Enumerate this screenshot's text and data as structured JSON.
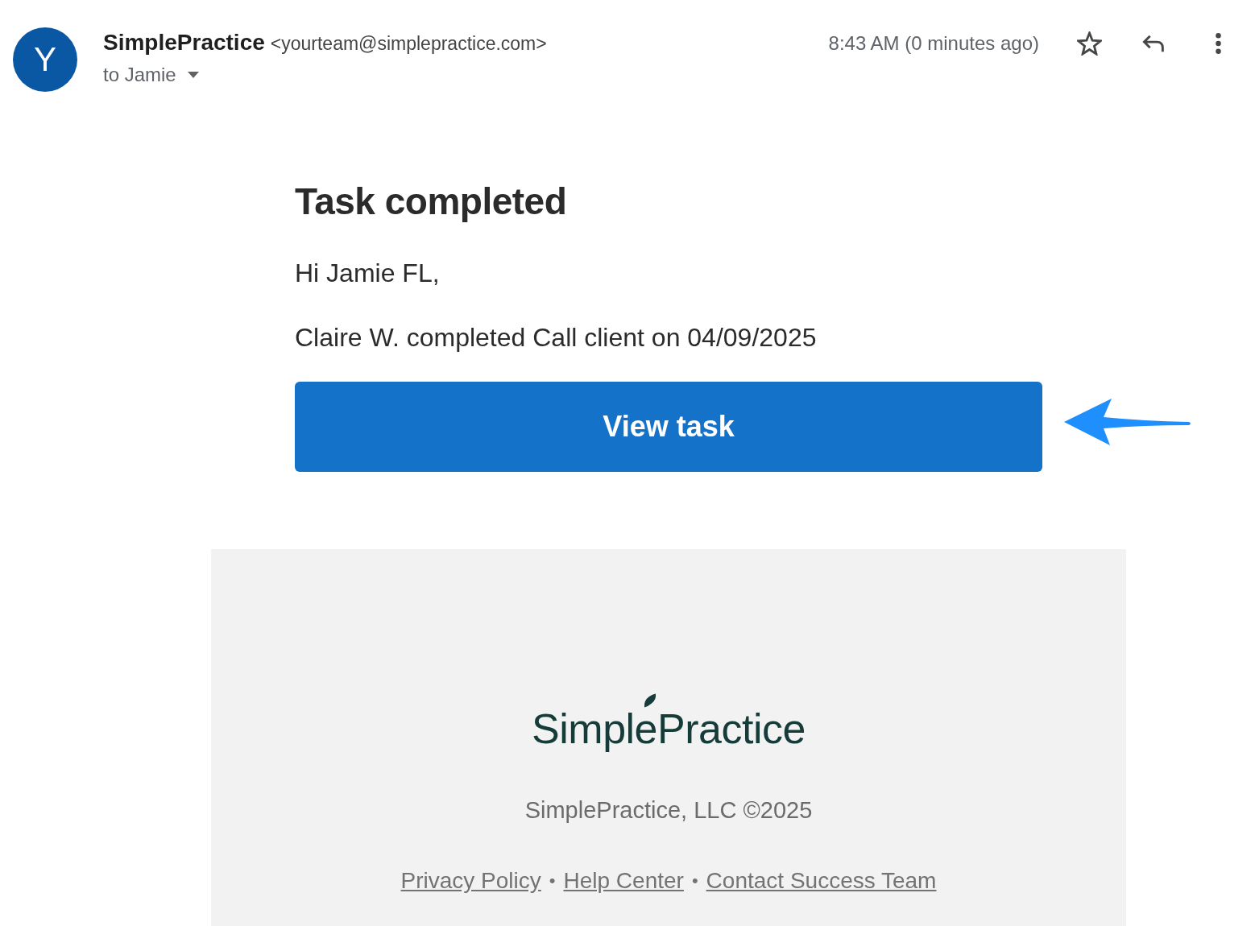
{
  "header": {
    "avatar": {
      "letter": "Y"
    },
    "sender_name": "SimplePractice",
    "sender_email": "<yourteam@simplepractice.com>",
    "recipient": "to Jamie",
    "time": "8:43 AM (0 minutes ago)",
    "starred": false
  },
  "body": {
    "title": "Task completed",
    "greeting": "Hi Jamie FL,",
    "message": "Claire W. completed Call client on 04/09/2025",
    "button": "View task"
  },
  "footer": {
    "logo": "SimplePractice",
    "copyright": "SimplePractice, LLC ©2025",
    "link_row": [
      {
        "kind": "link",
        "text": "Privacy Policy"
      },
      {
        "kind": "separator",
        "text": "•"
      },
      {
        "kind": "link",
        "text": "Help Center"
      },
      {
        "kind": "separator",
        "text": "•"
      },
      {
        "kind": "link",
        "text": "Contact Success Team"
      }
    ]
  }
}
